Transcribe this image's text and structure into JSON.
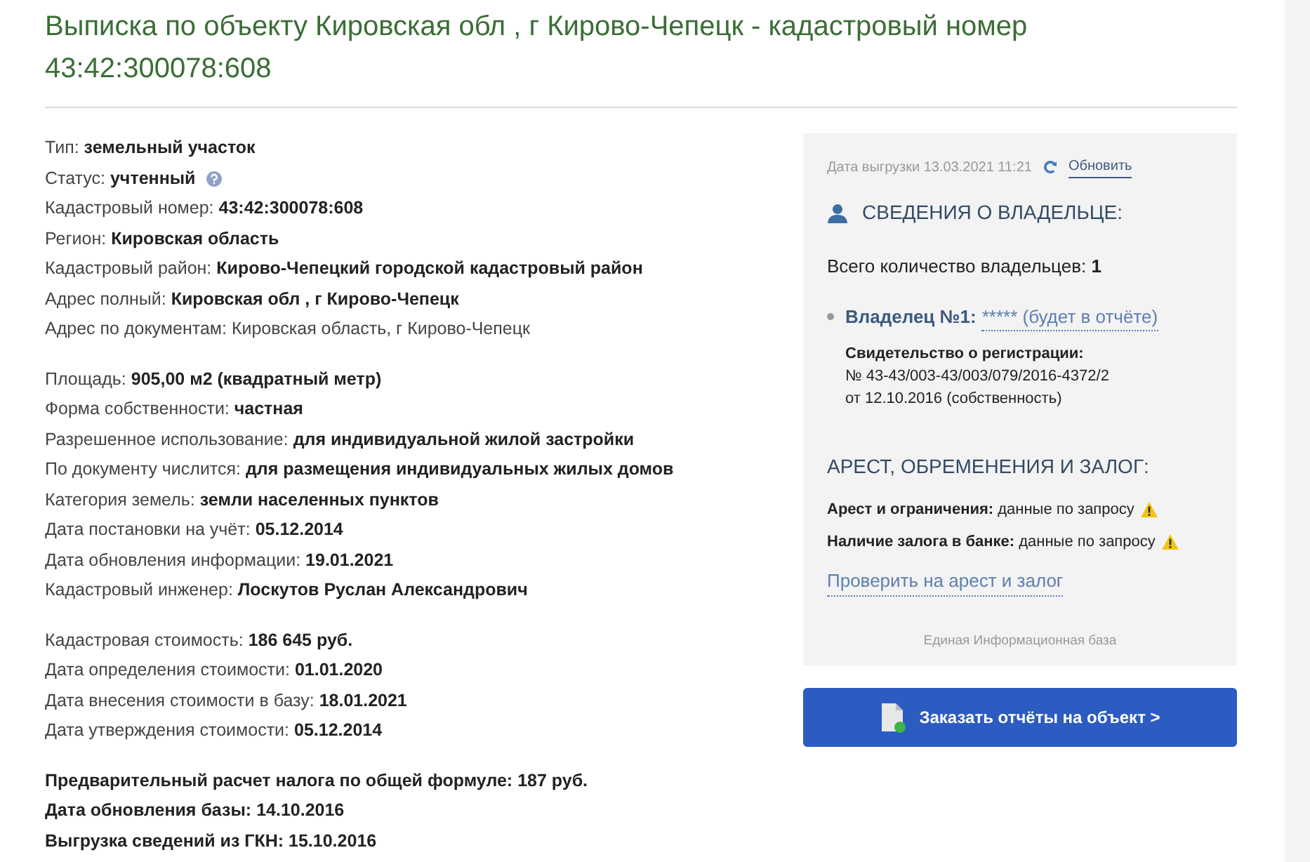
{
  "title": "Выписка по объекту Кировская обл , г Кирово-Чепецк - кадастровый номер 43:42:300078:608",
  "groups": [
    [
      {
        "label": "Тип:",
        "value": "земельный участок",
        "kind": "plain",
        "help": false
      },
      {
        "label": "Статус:",
        "value": "учтенный",
        "kind": "plain",
        "help": true
      },
      {
        "label": "Кадастровый номер:",
        "value": "43:42:300078:608",
        "kind": "plain",
        "help": false
      },
      {
        "label": "Регион:",
        "value": "Кировская область",
        "kind": "plain",
        "help": false
      },
      {
        "label": "Кадастровый район:",
        "value": "Кирово-Чепецкий городской кадастровый район",
        "kind": "plain",
        "help": false
      },
      {
        "label": "Адрес полный:",
        "value": "Кировская обл , г Кирово-Чепецк",
        "kind": "plain",
        "help": false
      },
      {
        "label": "Адрес по документам:",
        "value": "Кировская область, г Кирово-Чепецк",
        "kind": "light",
        "help": false
      }
    ],
    [
      {
        "label": "Площадь:",
        "value": "905,00 м2 (квадратный метр)",
        "kind": "plain",
        "help": false
      },
      {
        "label": "Форма собственности:",
        "value": "частная",
        "kind": "plain",
        "help": false
      },
      {
        "label": "Разрешенное использование:",
        "value": "для индивидуальной жилой застройки",
        "kind": "plain",
        "help": false
      },
      {
        "label": "По документу числится:",
        "value": "для размещения индивидуальных жилых домов",
        "kind": "plain",
        "help": false
      },
      {
        "label": "Категория земель:",
        "value": "земли населенных пунктов",
        "kind": "plain",
        "help": false
      },
      {
        "label": "Дата постановки на учёт:",
        "value": "05.12.2014",
        "kind": "plain",
        "help": false
      },
      {
        "label": "Дата обновления информации:",
        "value": "19.01.2021",
        "kind": "plain",
        "help": false
      },
      {
        "label": "Кадастровый инженер:",
        "value": "Лоскутов Руслан Александрович",
        "kind": "plain",
        "help": false
      }
    ],
    [
      {
        "label": "Кадастровая стоимость:",
        "value": "186 645 руб.",
        "kind": "plain",
        "help": false
      },
      {
        "label": "Дата определения стоимости:",
        "value": "01.01.2020",
        "kind": "plain",
        "help": false
      },
      {
        "label": "Дата внесения стоимости в базу:",
        "value": "18.01.2021",
        "kind": "plain",
        "help": false
      },
      {
        "label": "Дата утверждения стоимости:",
        "value": "05.12.2014",
        "kind": "plain",
        "help": false
      }
    ],
    [
      {
        "label": "Предварительный расчет налога по общей формуле:",
        "value": "187 руб.",
        "kind": "bold",
        "help": false
      },
      {
        "label": "Дата обновления базы:",
        "value": "14.10.2016",
        "kind": "bold",
        "help": false
      },
      {
        "label": "Выгрузка сведений из ГКН:",
        "value": "15.10.2016",
        "kind": "bold",
        "help": false
      }
    ]
  ],
  "panel": {
    "export_date": "Дата выгрузки 13.03.2021 11:21",
    "refresh_link": "Обновить",
    "owner_heading": "СВЕДЕНИЯ О ВЛАДЕЛЬЦЕ:",
    "owner_count_label": "Всего количество владельцев:",
    "owner_count": "1",
    "owners": [
      {
        "label": "Владелец №1:",
        "link": "***** (будет в отчёте)",
        "certificate_label": "Свидетельство о регистрации:",
        "certificate_lines": [
          "№ 43-43/003-43/003/079/2016-4372/2",
          "от 12.10.2016 (собственность)"
        ]
      }
    ],
    "encumbrance_heading": "АРЕСТ, ОБРЕМЕНЕНИЯ И ЗАЛОГ:",
    "encumbrances": [
      {
        "label": "Арест и ограничения:",
        "value": "данные по запросу",
        "warning": true
      },
      {
        "label": "Наличие залога в банке:",
        "value": "данные по запросу",
        "warning": true
      }
    ],
    "check_link": "Проверить на арест и залог",
    "footer": "Единая Информационная база"
  },
  "order_button": "Заказать отчёты на объект >"
}
